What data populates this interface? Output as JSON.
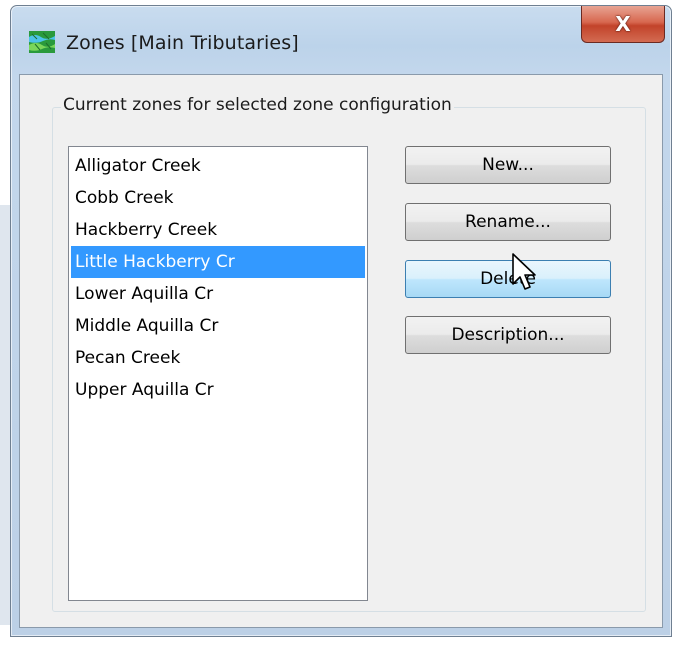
{
  "window": {
    "title": "Zones [Main Tributaries]",
    "close_label": "X"
  },
  "group": {
    "label": "Current zones for selected zone configuration"
  },
  "zones": [
    {
      "label": "Alligator Creek",
      "selected": false
    },
    {
      "label": "Cobb Creek",
      "selected": false
    },
    {
      "label": "Hackberry Creek",
      "selected": false
    },
    {
      "label": "Little Hackberry Cr",
      "selected": true
    },
    {
      "label": "Lower Aquilla Cr",
      "selected": false
    },
    {
      "label": "Middle Aquilla Cr",
      "selected": false
    },
    {
      "label": "Pecan Creek",
      "selected": false
    },
    {
      "label": "Upper Aquilla Cr",
      "selected": false
    }
  ],
  "buttons": {
    "new": "New...",
    "rename": "Rename...",
    "delete": "Delete",
    "description": "Description..."
  },
  "colors": {
    "selection": "#3399ff",
    "close_button": "#c2432a",
    "hover_button": "#bee6fd"
  },
  "icons": {
    "app": "zones-map-icon",
    "close": "close-icon",
    "cursor": "mouse-pointer-icon"
  }
}
